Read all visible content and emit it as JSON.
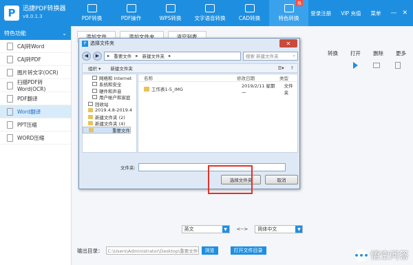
{
  "app": {
    "name": "迅捷PDF转换器",
    "version": "v8.0.1.3",
    "logo_letter": "P"
  },
  "nav": [
    {
      "label": "PDF转换",
      "icon": "pdf-convert-icon"
    },
    {
      "label": "PDF操作",
      "icon": "pdf-operate-icon"
    },
    {
      "label": "WPS转换",
      "icon": "wps-convert-icon"
    },
    {
      "label": "文字语音转换",
      "icon": "text-speech-icon"
    },
    {
      "label": "CAD转换",
      "icon": "cad-convert-icon"
    },
    {
      "label": "特色转换",
      "icon": "special-convert-icon",
      "badge": "热"
    }
  ],
  "top_right": {
    "login": "登录注册",
    "vip": "VIP 充值",
    "menu": "菜单"
  },
  "sidebar": {
    "header": "特色功能",
    "items": [
      {
        "label": "CAJ转Word"
      },
      {
        "label": "CAJ转PDF"
      },
      {
        "label": "图片转文字(OCR)"
      },
      {
        "label": "扫描PDF转Word(OCR)"
      },
      {
        "label": "PDF翻译"
      },
      {
        "label": "Word翻译",
        "active": true
      },
      {
        "label": "PPT压缩"
      },
      {
        "label": "WORD压缩"
      }
    ]
  },
  "toolbar": {
    "add_file": "添加文件",
    "add_folder": "添加文件夹",
    "clear_list": "清空列表"
  },
  "columns": {
    "convert": "转换",
    "open": "打开",
    "delete": "删除",
    "more": "更多"
  },
  "language": {
    "from": "英文",
    "arrow": "<-->",
    "to": "简体中文"
  },
  "output": {
    "label": "输出目录：",
    "path": "C:\\Users\\Administrator\\Desktop\\重要文件\\",
    "browse": "浏览",
    "open_dir": "打开文件目录"
  },
  "watermark": "悟空问答",
  "dialog": {
    "title": "选择文件夹",
    "address": [
      "重要文件",
      "新建文件夹"
    ],
    "search_placeholder": "搜索 新建文件夹",
    "organize": "组织 ▾",
    "new_folder": "新建文件夹",
    "tree": [
      {
        "label": "网络和 Internet",
        "type": "ctrl"
      },
      {
        "label": "系统和安全",
        "type": "ctrl"
      },
      {
        "label": "硬件和声音",
        "type": "ctrl"
      },
      {
        "label": "用户帐户和家庭",
        "type": "ctrl"
      },
      {
        "label": "回收站",
        "type": "ctrl"
      },
      {
        "label": "2019.4.8-2019.4",
        "type": "folder"
      },
      {
        "label": "新建文件夹 (2)",
        "type": "folder"
      },
      {
        "label": "新建文件夹 (4)",
        "type": "folder"
      },
      {
        "label": "重要文件",
        "type": "folder",
        "selected": true
      }
    ],
    "headers": {
      "name": "名称",
      "date": "修改日期",
      "type": "类型"
    },
    "files": [
      {
        "name": "工作表1-5_IMG",
        "date": "2019/2/11 星期一",
        "type": "文件夹"
      }
    ],
    "folder_label": "文件夹:",
    "select_btn": "选择文件夹",
    "cancel_btn": "取消"
  }
}
